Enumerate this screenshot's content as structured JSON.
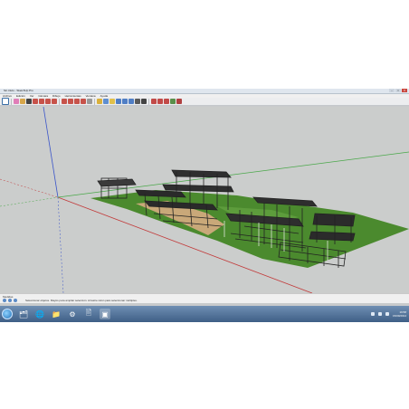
{
  "window": {
    "title": "Sin título - SketchUp Pro",
    "controls": [
      "–",
      "□",
      "✕"
    ]
  },
  "menubar": {
    "items": [
      "Archivo",
      "Edición",
      "Ver",
      "Cámara",
      "Dibujo",
      "Herramientas",
      "Ventana",
      "Ayuda"
    ]
  },
  "toolbar": {
    "icons": [
      {
        "name": "select-icon",
        "color": "#ffffff"
      },
      {
        "name": "eraser-icon",
        "color": "#e07db8"
      },
      {
        "name": "pencil-icon",
        "color": "#d7a64a"
      },
      {
        "name": "line-icon",
        "color": "#444444"
      },
      {
        "name": "arc-icon",
        "color": "#c7524a"
      },
      {
        "name": "rectangle-icon",
        "color": "#c7524a"
      },
      {
        "name": "circle-icon",
        "color": "#c7524a"
      },
      {
        "name": "polygon-icon",
        "color": "#c7524a"
      },
      {
        "name": "pushpull-icon",
        "color": "#c7524a"
      },
      {
        "name": "move-icon",
        "color": "#c7524a"
      },
      {
        "name": "rotate-icon",
        "color": "#c7524a"
      },
      {
        "name": "offset-icon",
        "color": "#c7524a"
      },
      {
        "name": "tape-icon",
        "color": "#999999"
      },
      {
        "name": "text-icon",
        "color": "#d9b03b"
      },
      {
        "name": "orbit-icon",
        "color": "#5e8ed0"
      },
      {
        "name": "pan-icon",
        "color": "#e1c04a"
      },
      {
        "name": "zoom-icon",
        "color": "#4f7ec5"
      },
      {
        "name": "zoom-window-icon",
        "color": "#4f7ec5"
      },
      {
        "name": "zoom-extents-icon",
        "color": "#4f7ec5"
      },
      {
        "name": "walk-icon",
        "color": "#5a5a5a"
      },
      {
        "name": "look-around-icon",
        "color": "#444444"
      },
      {
        "name": "section-icon",
        "color": "#c24a48"
      },
      {
        "name": "materials-icon",
        "color": "#c24a48"
      },
      {
        "name": "components-icon",
        "color": "#c24a48"
      },
      {
        "name": "warehouse-icon",
        "color": "#5a8f4a"
      },
      {
        "name": "extension-icon",
        "color": "#b04040"
      }
    ]
  },
  "statusbar": {
    "measurements_label": "Medidas",
    "hint": "Seleccionar objetos. Mayús para ampliar selección. Arrastre ratón para seleccionar múltiples."
  },
  "taskbar": {
    "apps": [
      "🗂",
      "🌐",
      "📁",
      "⚙",
      "🖹",
      "▣"
    ],
    "time": "19:58",
    "date": "15/09/2014"
  },
  "colors": {
    "sky": "#cbcdcc",
    "ground_green": "#4b8a2e",
    "path_tan": "#c9a879",
    "steel": "#222222",
    "axis_red": "#c23a3a",
    "axis_green": "#4aa84a",
    "axis_blue": "#3b55c9"
  }
}
